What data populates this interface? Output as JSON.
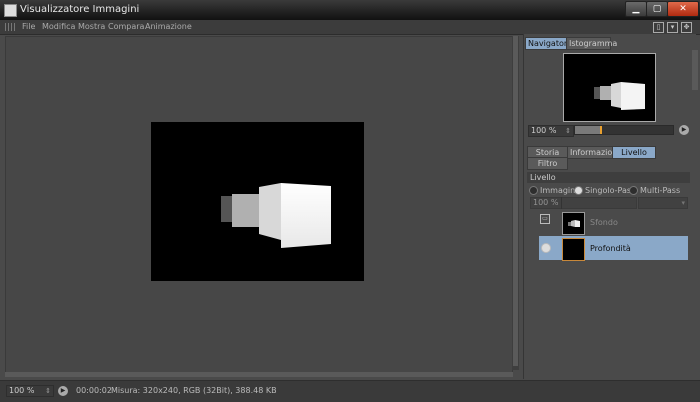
{
  "window": {
    "title": "Visualizzatore Immagini"
  },
  "menu": [
    {
      "label": "File"
    },
    {
      "label": "Modifica"
    },
    {
      "label": "Mostra"
    },
    {
      "label": "Compara"
    },
    {
      "label": "Animazione"
    }
  ],
  "panel": {
    "tabs": [
      {
        "label": "Navigatore",
        "active": true
      },
      {
        "label": "Istogramma",
        "active": false
      }
    ],
    "zoom": "100 %",
    "zoom_level": 0.25,
    "sub_tabs": [
      {
        "label": "Storia",
        "active": false
      },
      {
        "label": "Informazioni",
        "active": false
      },
      {
        "label": "Livello",
        "active": true
      },
      {
        "label": "Filtro",
        "active": false
      }
    ],
    "section_title": "Livello",
    "modes": [
      {
        "label": "Immagine",
        "selected": false
      },
      {
        "label": "Singolo-Pass",
        "selected": true
      },
      {
        "label": "Multi-Pass",
        "selected": false
      }
    ],
    "opacity": "100 %",
    "layers": [
      {
        "name": "Sfondo",
        "selected": false
      },
      {
        "name": "Profondità",
        "selected": true
      }
    ]
  },
  "status": {
    "zoom": "100 %",
    "time": "00:00:02",
    "info": "Misura: 320x240, RGB (32Bit), 388.48 KB"
  },
  "colors": {
    "accent": "#8aa8c8",
    "slider_knob": "#e8a030",
    "close_button": "#c8401e"
  }
}
